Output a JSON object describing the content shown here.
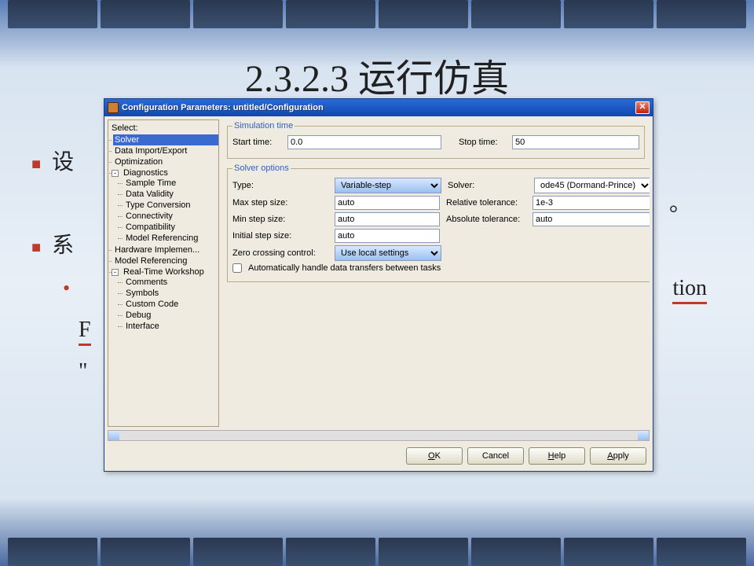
{
  "slide": {
    "title": "2.3.2.3 运行仿真",
    "line1_pre": "设",
    "line1_post": "。",
    "line2": "系",
    "line3_tail": "tion",
    "line4_char": "F",
    "line5_char": "\"",
    "line5_tail": "。"
  },
  "dialog": {
    "title": "Configuration Parameters: untitled/Configuration",
    "tree_header": "Select:",
    "tree": {
      "solver": "Solver",
      "data_io": "Data Import/Export",
      "optimization": "Optimization",
      "diagnostics": "Diagnostics",
      "diag_children": {
        "sample_time": "Sample Time",
        "data_validity": "Data Validity",
        "type_conversion": "Type Conversion",
        "connectivity": "Connectivity",
        "compatibility": "Compatibility",
        "model_ref": "Model Referencing"
      },
      "hw": "Hardware Implemen...",
      "model_ref2": "Model Referencing",
      "rtw": "Real-Time Workshop",
      "rtw_children": {
        "comments": "Comments",
        "symbols": "Symbols",
        "custom_code": "Custom Code",
        "debug": "Debug",
        "interface": "Interface"
      }
    },
    "sim_time": {
      "legend": "Simulation time",
      "start_label": "Start time:",
      "start_value": "0.0",
      "stop_label": "Stop time:",
      "stop_value": "50"
    },
    "solver_opts": {
      "legend": "Solver options",
      "type_label": "Type:",
      "type_value": "Variable-step",
      "solver_label": "Solver:",
      "solver_value": "ode45 (Dormand-Prince)",
      "max_step_label": "Max step size:",
      "max_step_value": "auto",
      "rel_tol_label": "Relative tolerance:",
      "rel_tol_value": "1e-3",
      "min_step_label": "Min step size:",
      "min_step_value": "auto",
      "abs_tol_label": "Absolute tolerance:",
      "abs_tol_value": "auto",
      "init_step_label": "Initial step size:",
      "init_step_value": "auto",
      "zcc_label": "Zero crossing control:",
      "zcc_value": "Use local settings",
      "auto_cb": "Automatically handle data transfers between tasks"
    },
    "buttons": {
      "ok": "OK",
      "cancel": "Cancel",
      "help": "Help",
      "apply": "Apply"
    }
  }
}
